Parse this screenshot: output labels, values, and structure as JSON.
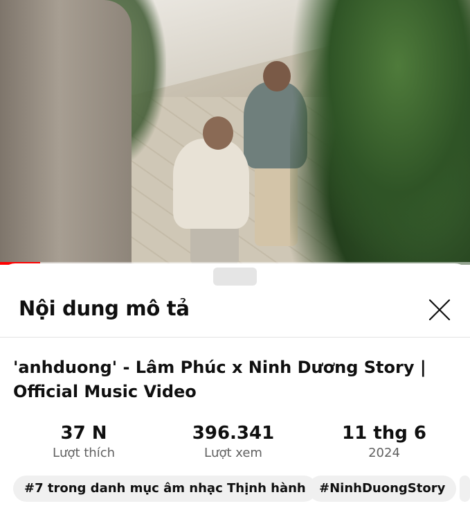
{
  "video": {
    "progress": 0.085,
    "accent_color": "#ff0000"
  },
  "sheet": {
    "title": "Nội dung mô tả",
    "close_icon": "close-icon"
  },
  "description": {
    "video_title": "'anhduong' - Lâm Phúc x Ninh Dương Story | Official Music Video",
    "stats": [
      {
        "value": "37 N",
        "label": "Lượt thích"
      },
      {
        "value": "396.341",
        "label": "Lượt xem"
      },
      {
        "value": "11 thg 6",
        "label": "2024"
      }
    ],
    "chips": [
      {
        "label": "#7 trong danh mục âm nhạc Thịnh hành"
      },
      {
        "label": "#NinhDuongStory"
      }
    ]
  }
}
